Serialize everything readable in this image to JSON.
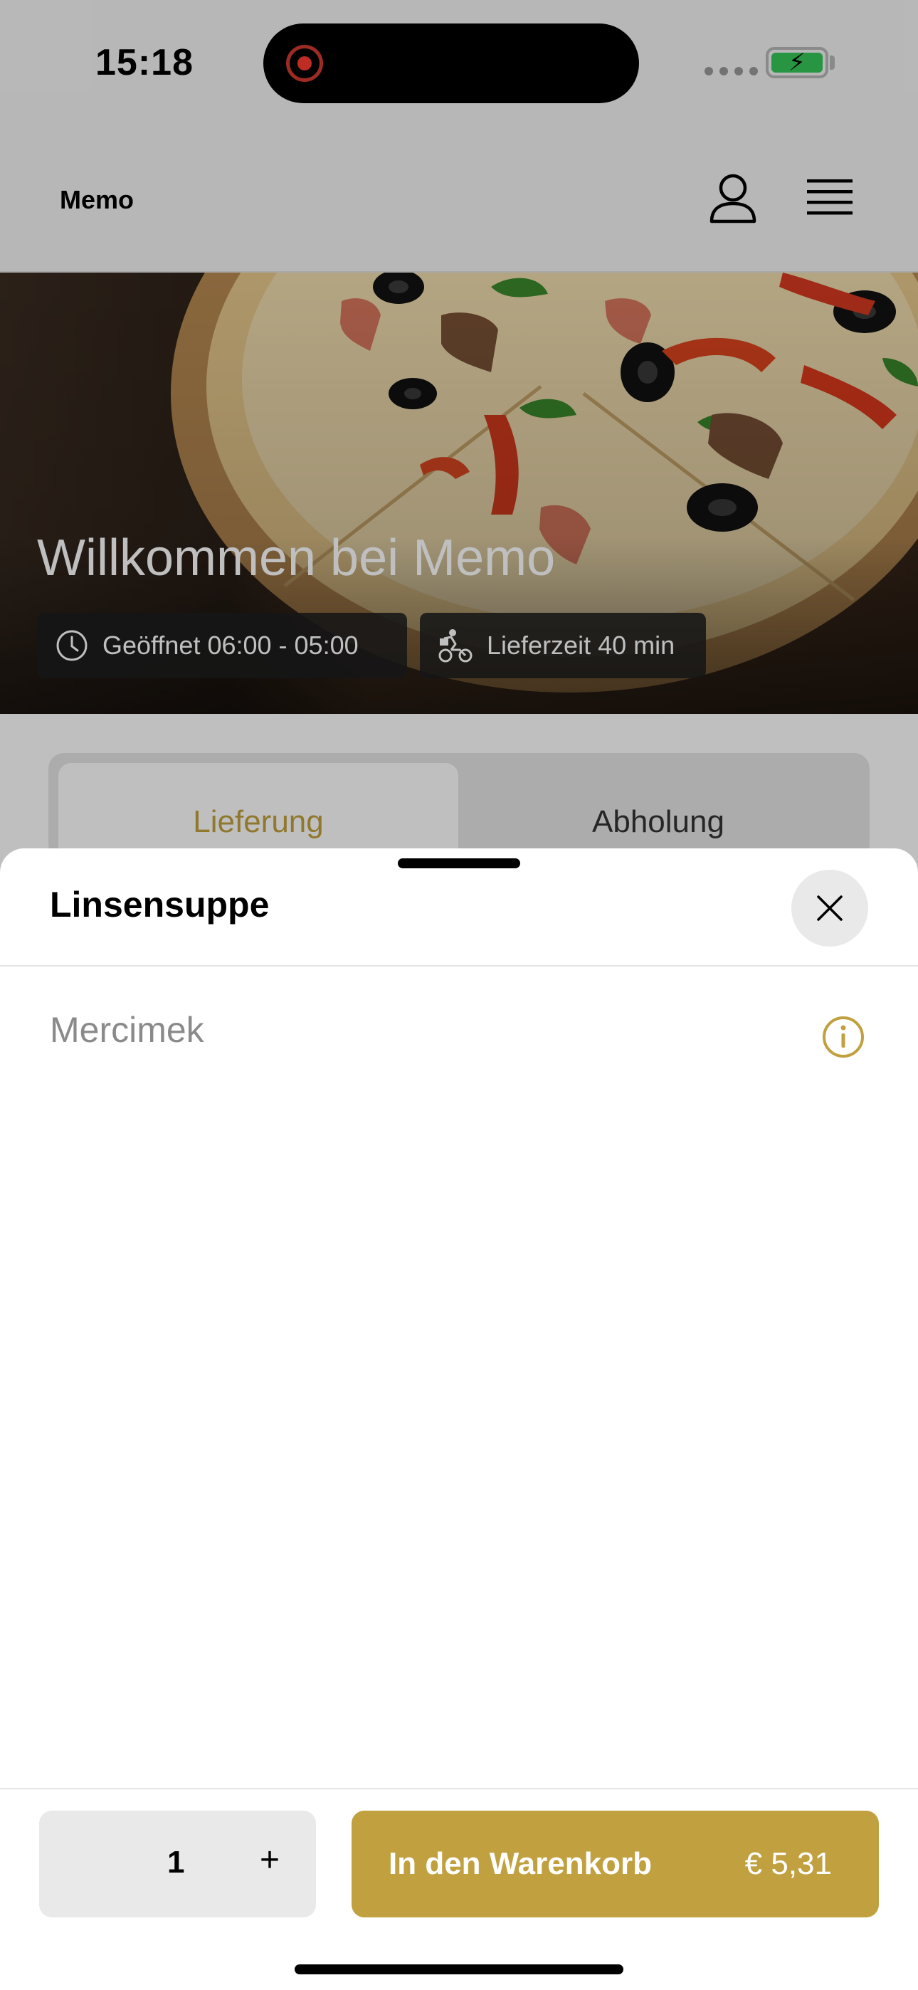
{
  "status_bar": {
    "time": "15:18"
  },
  "header": {
    "brand": "Memo",
    "profile_icon": "person-icon",
    "menu_icon": "hamburger-menu-icon"
  },
  "hero": {
    "title": "Willkommen bei Memo",
    "opening_hours": "Geöffnet 06:00 - 05:00",
    "delivery_time": "Lieferzeit 40 min"
  },
  "mode_toggle": {
    "tabs": [
      {
        "label": "Lieferung",
        "active": true
      },
      {
        "label": "Abholung",
        "active": false
      }
    ]
  },
  "sheet": {
    "title": "Linsensuppe",
    "description": "Mercimek",
    "quantity": "1",
    "plus_label": "+",
    "add_to_cart_label": "In den Warenkorb",
    "price": "€ 5,31"
  },
  "colors": {
    "accent": "#c1a03f",
    "recording": "#ff3b30",
    "battery": "#34c759"
  }
}
